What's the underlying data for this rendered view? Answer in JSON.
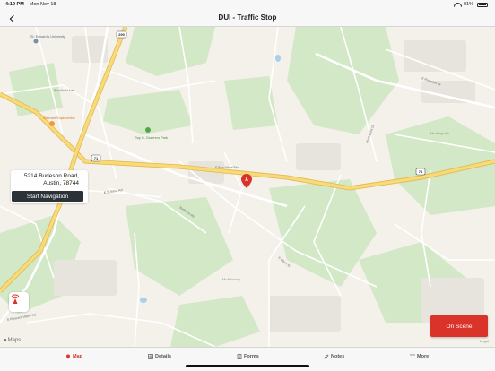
{
  "status_bar": {
    "time": "4:19 PM",
    "date": "Mon Nov 18",
    "battery": "91%"
  },
  "nav": {
    "title": "DUI - Traffic Stop"
  },
  "map": {
    "highway_shields": [
      "290",
      "71",
      "71"
    ],
    "road_labels": [
      "E Riverside Dr",
      "Woodland Ave",
      "Burleson Rd",
      "E Ben White Blvd",
      "Montopolis Dr",
      "S Pleasant Valley Rd",
      "E St Elmo Rd",
      "E Oltorf St"
    ],
    "place_labels": [
      "St. Edward's University",
      "Walmart Supercenter",
      "Roy G. Guerrero Park",
      "McKinney",
      "Montopolis"
    ],
    "pin_marker": "A"
  },
  "address_card": {
    "line1": "5214  Burleson Road,",
    "line2": "Austin, 78744",
    "button_label": "Start Navigation"
  },
  "map_footer": {
    "logo": "Maps",
    "legal": "Legal"
  },
  "actions": {
    "on_scene": "On Scene"
  },
  "tabs": [
    {
      "label": "Map",
      "icon": "map-pin-icon",
      "active": true
    },
    {
      "label": "Details",
      "icon": "details-grid-icon",
      "active": false
    },
    {
      "label": "Forms",
      "icon": "forms-doc-icon",
      "active": false
    },
    {
      "label": "Notes",
      "icon": "pencil-icon",
      "active": false
    },
    {
      "label": "More",
      "icon": "ellipsis-icon",
      "active": false
    }
  ],
  "colors": {
    "accent": "#d9332a",
    "nav_button": "#2b3238",
    "highway": "#f3d36b",
    "park": "#cfe6c1"
  }
}
